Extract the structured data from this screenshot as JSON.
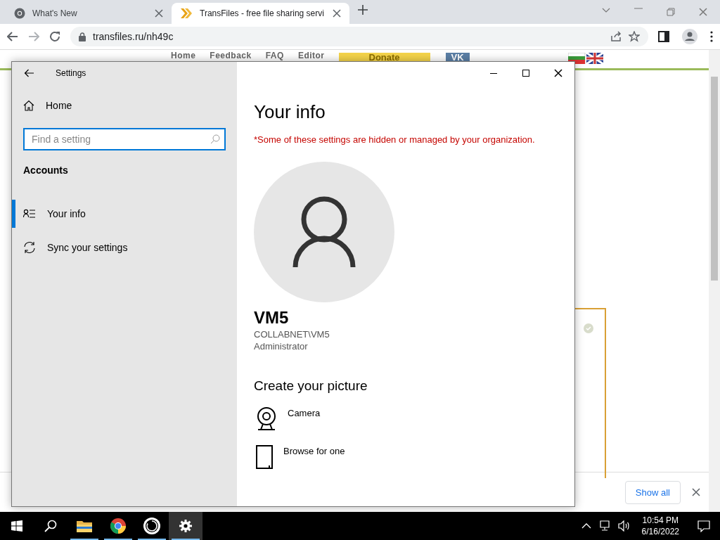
{
  "browser": {
    "tabs": [
      {
        "title": "What's New",
        "kind": "chrome",
        "selected": false
      },
      {
        "title": "TransFiles - free file sharing servi",
        "kind": "transfiles",
        "selected": true
      }
    ],
    "url": "transfiles.ru/nh49c",
    "page": {
      "nav": [
        {
          "label": "Home",
          "kind": "link"
        },
        {
          "label": "Feedback",
          "kind": "link"
        },
        {
          "label": "FAQ",
          "kind": "link"
        },
        {
          "label": "Editor",
          "kind": "link"
        },
        {
          "label": "Donate",
          "kind": "donate"
        },
        {
          "label": "VK",
          "kind": "vk"
        }
      ]
    },
    "download_bar": {
      "button": "Show all"
    }
  },
  "settings": {
    "title": "Settings",
    "home": "Home",
    "search": {
      "placeholder": "Find a setting"
    },
    "section": "Accounts",
    "items": [
      {
        "label": "Your info",
        "kind": "info",
        "selected": true
      },
      {
        "label": "Sync your settings",
        "kind": "sync",
        "selected": false
      }
    ],
    "heading": "Your info",
    "notice": "*Some of these settings are hidden or managed by your organization.",
    "user": {
      "name": "VM5",
      "account": "COLLABNET\\VM5",
      "role": "Administrator"
    },
    "create_heading": "Create your picture",
    "options": [
      {
        "label": "Camera",
        "kind": "camera"
      },
      {
        "label": "Browse for one",
        "kind": "browse"
      }
    ]
  },
  "taskbar": {
    "apps": [
      {
        "kind": "explorer",
        "selected": false
      },
      {
        "kind": "chrome",
        "selected": false
      },
      {
        "kind": "circle",
        "selected": false
      },
      {
        "kind": "settings",
        "selected": true
      }
    ],
    "time": "10:54 PM",
    "date": "6/16/2022"
  }
}
